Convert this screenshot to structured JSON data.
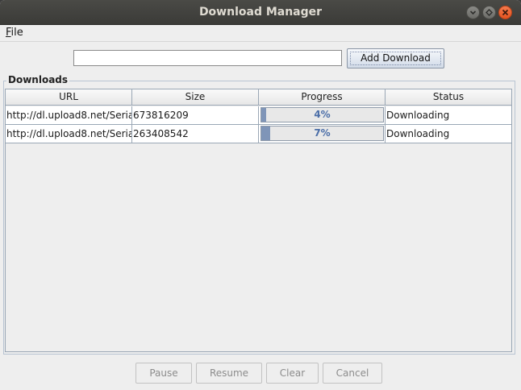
{
  "window": {
    "title": "Download Manager"
  },
  "menu": {
    "file_mnemonic": "F",
    "file_rest": "ile"
  },
  "toolbar": {
    "url_value": "",
    "add_label": "Add Download"
  },
  "downloads": {
    "group_title": "Downloads",
    "columns": [
      "URL",
      "Size",
      "Progress",
      "Status"
    ],
    "rows": [
      {
        "url": "http://dl.upload8.net/Seria...",
        "size": "673816209",
        "progress_label": "4%",
        "progress": 0.04,
        "status": "Downloading"
      },
      {
        "url": "http://dl.upload8.net/Seria...",
        "size": "263408542",
        "progress_label": "7%",
        "progress": 0.07,
        "status": "Downloading"
      }
    ]
  },
  "buttons": {
    "pause": "Pause",
    "resume": "Resume",
    "clear": "Clear",
    "cancel": "Cancel"
  },
  "icons": {
    "minimize": "minimize-icon",
    "maximize": "maximize-icon",
    "close": "close-icon"
  },
  "colors": {
    "progress_fill": "#7f95b8",
    "progress_text": "#4b6ea8",
    "close_button": "#e5531f"
  }
}
